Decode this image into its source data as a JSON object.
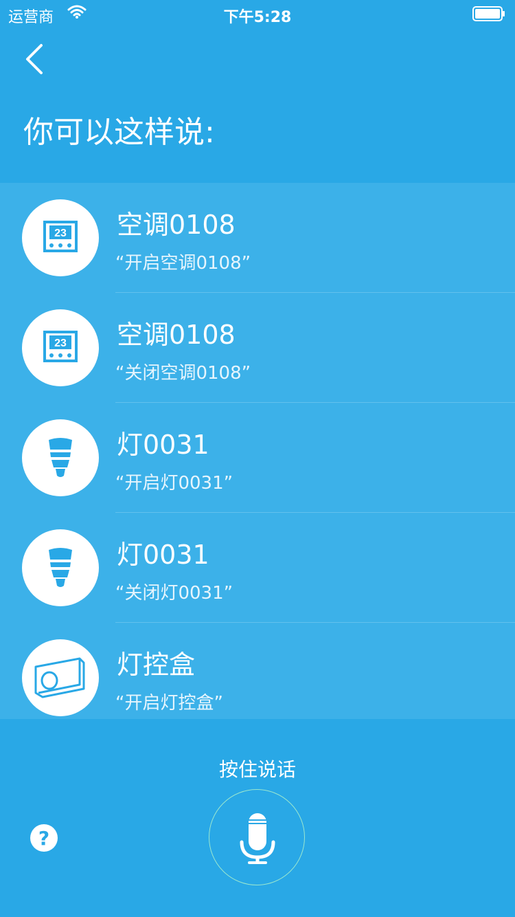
{
  "status_bar": {
    "carrier": "运营商",
    "time": "下午5:28"
  },
  "header": {
    "title": "你可以这样说:"
  },
  "commands": [
    {
      "name": "空调0108",
      "phrase": "“开启空调0108”",
      "icon": "thermostat-icon"
    },
    {
      "name": "空调0108",
      "phrase": "“关闭空调0108”",
      "icon": "thermostat-icon"
    },
    {
      "name": "灯0031",
      "phrase": "“开启灯0031”",
      "icon": "bulb-icon"
    },
    {
      "name": "灯0031",
      "phrase": "“关闭灯0031”",
      "icon": "bulb-icon"
    },
    {
      "name": "灯控盒",
      "phrase": "“开启灯控盒”",
      "icon": "light-control-box-icon"
    }
  ],
  "thermostat_display": "23",
  "footer": {
    "hold_to_talk": "按住说话",
    "help_symbol": "?"
  },
  "colors": {
    "background": "#29a8e6",
    "list_background": "#3cb1e9",
    "icon_blue": "#29a8e6",
    "mic_ring": "#9be8cf"
  }
}
